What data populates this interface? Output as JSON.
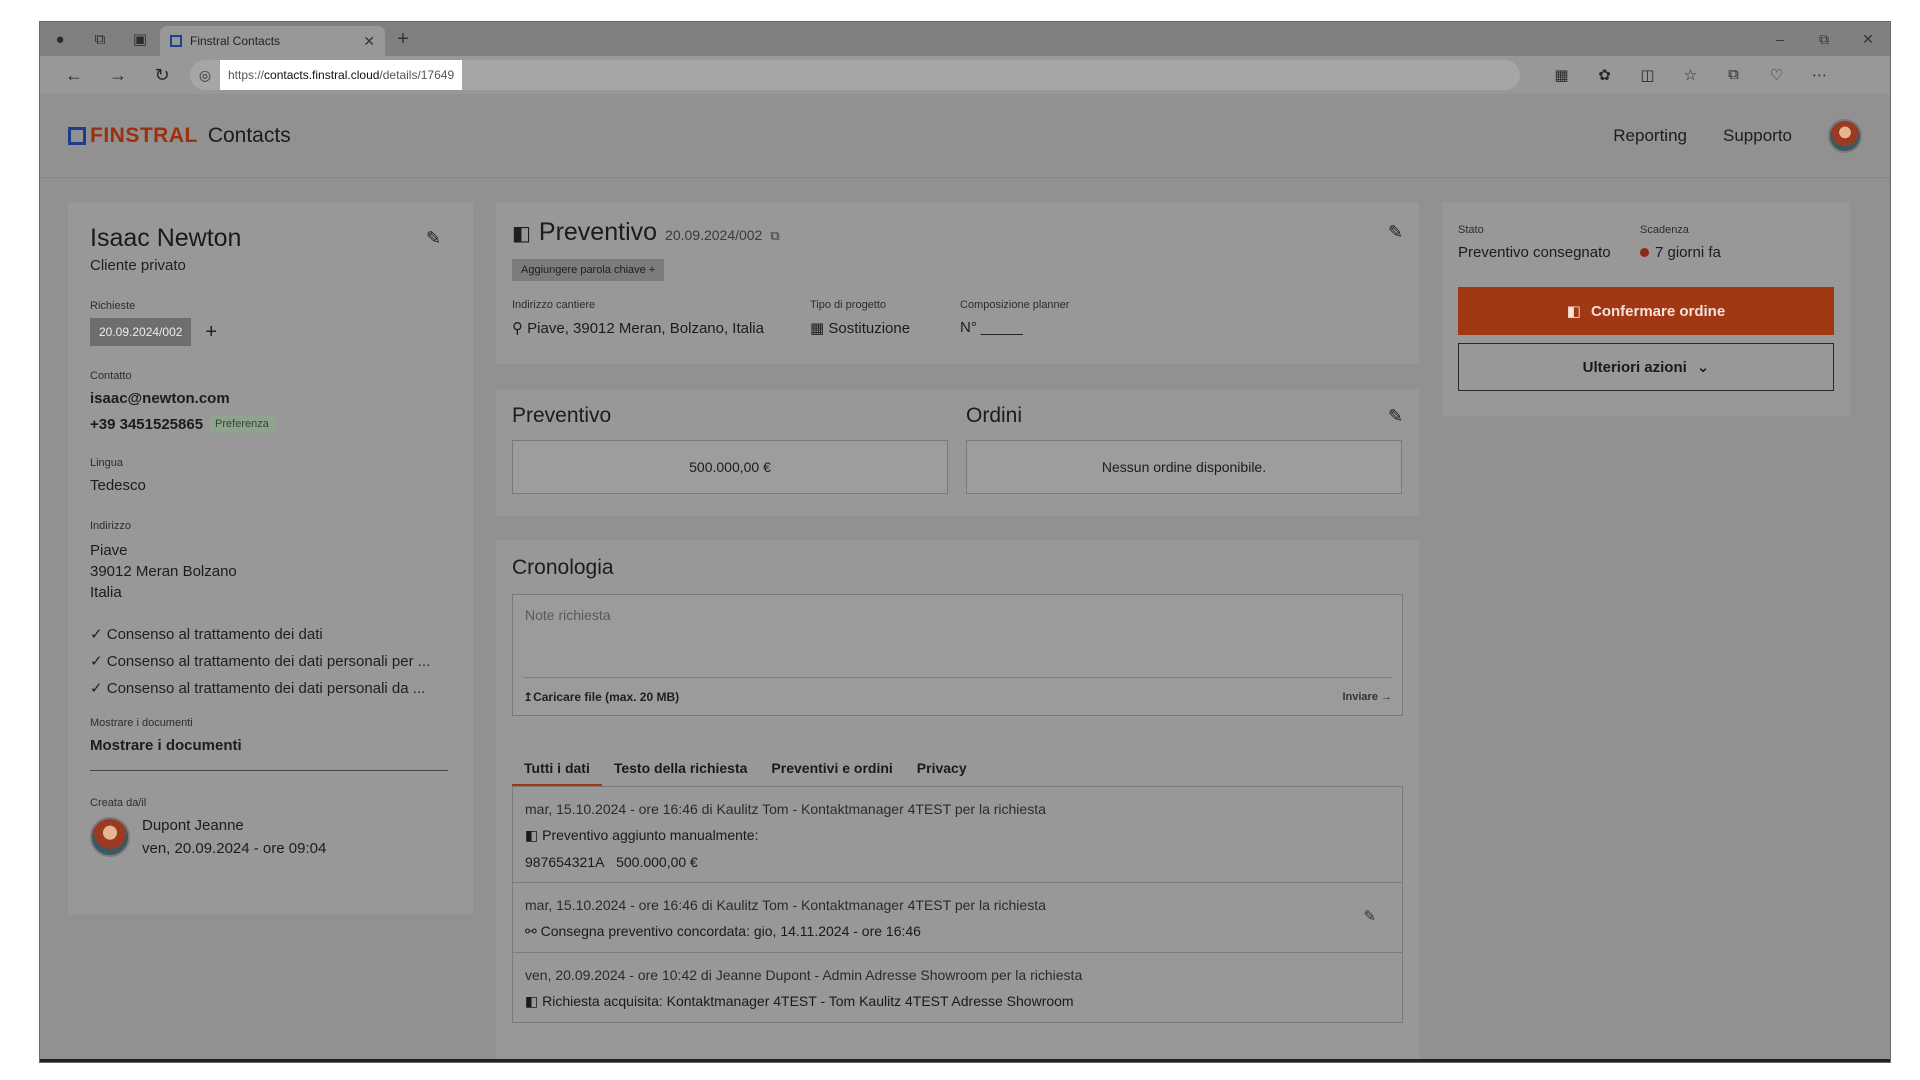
{
  "browser": {
    "tab_title": "Finstral Contacts",
    "tab_close": "✕",
    "new_tab": "+",
    "url_prefix": "https://",
    "url_host": "contacts.finstral.cloud",
    "url_path": "/details/17649"
  },
  "app": {
    "logo_word": "FINSTRAL",
    "app_name": "Contacts",
    "nav": {
      "reporting": "Reporting",
      "support": "Supporto"
    }
  },
  "customer": {
    "name": "Isaac Newton",
    "type": "Cliente privato",
    "requests_label": "Richieste",
    "request_chip": "20.09.2024/002",
    "add": "+",
    "contact_label": "Contatto",
    "email": "isaac@newton.com",
    "phone": "+39 3451525865",
    "phone_badge": "Preferenza",
    "language_label": "Lingua",
    "language": "Tedesco",
    "address_label": "Indirizzo",
    "address_line1": "Piave",
    "address_line2": "39012 Meran Bolzano",
    "address_line3": "Italia",
    "consents": [
      "Consenso al trattamento dei dati",
      "Consenso al trattamento dei dati personali per ...",
      "Consenso al trattamento dei dati personali da ..."
    ],
    "docs_label": "Mostrare i documenti",
    "docs_link": "Mostrare i documenti",
    "created_label": "Creata da/il",
    "created_by": "Dupont Jeanne",
    "created_at": "ven, 20.09.2024 - ore 09:04"
  },
  "quote_header": {
    "title": "Preventivo",
    "number": "20.09.2024/002",
    "keyword_button": "Aggiungere parola chiave  +",
    "site_label": "Indirizzo cantiere",
    "site_value": "Piave, 39012 Meran, Bolzano, Italia",
    "project_label": "Tipo di progetto",
    "project_value": "Sostituzione",
    "planner_label": "Composizione planner",
    "planner_value": "N° _____"
  },
  "summary": {
    "quote_title": "Preventivo",
    "quote_value": "500.000,00 €",
    "orders_title": "Ordini",
    "orders_value": "Nessun ordine disponibile."
  },
  "history": {
    "title": "Cronologia",
    "note_placeholder": "Note richiesta",
    "upload": "Caricare file (max. 20 MB)",
    "send": "Inviare →",
    "tabs": [
      "Tutti i dati",
      "Testo della richiesta",
      "Preventivi e ordini",
      "Privacy"
    ],
    "entries": [
      {
        "head": "mar, 15.10.2024 - ore 16:46 di Kaulitz Tom - Kontaktmanager 4TEST per la richiesta",
        "line1": "Preventivo aggiunto manualmente:",
        "line2a": "987654321A",
        "line2b": "500.000,00 €"
      },
      {
        "head": "mar, 15.10.2024 - ore 16:46 di Kaulitz Tom - Kontaktmanager 4TEST per la richiesta",
        "line1": "Consegna preventivo concordata: gio, 14.11.2024 - ore 16:46"
      },
      {
        "head": "ven, 20.09.2024 - ore 10:42 di Jeanne Dupont - Admin Adresse Showroom per la richiesta",
        "line1": "Richiesta acquisita: Kontaktmanager 4TEST - Tom Kaulitz 4TEST Adresse Showroom"
      }
    ]
  },
  "status": {
    "state_label": "Stato",
    "state_value": "Preventivo consegnato",
    "due_label": "Scadenza",
    "due_value": "7 giorni fa",
    "confirm_button": "Confermare ordine",
    "more_button": "Ulteriori azioni"
  },
  "colors": {
    "accent": "#a13713",
    "logo": "#9c2f0e",
    "logo_box": "#1e3c8c",
    "overlay_bg": "#919191"
  }
}
